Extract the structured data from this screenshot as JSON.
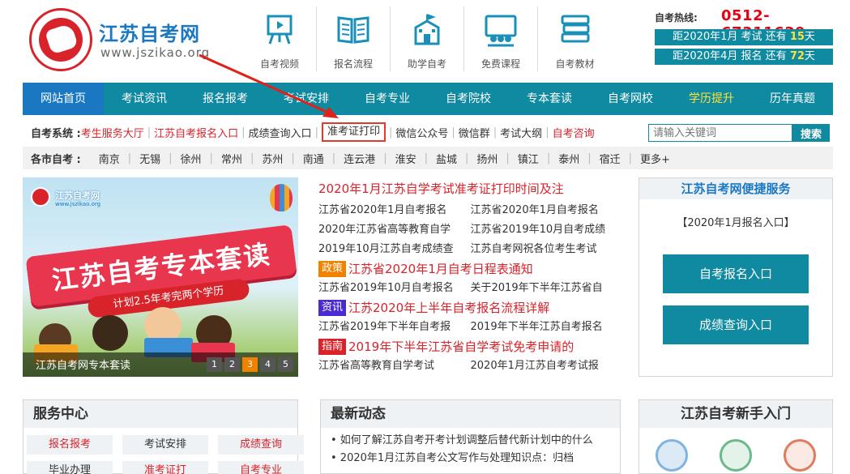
{
  "header": {
    "brand_name": "江苏自考网",
    "brand_url": "www.jszikao.org",
    "topnav": [
      {
        "label": "自考视频",
        "icon": "video-board-icon"
      },
      {
        "label": "报名流程",
        "icon": "book-icon"
      },
      {
        "label": "助学自考",
        "icon": "school-icon"
      },
      {
        "label": "免费课程",
        "icon": "classroom-icon"
      },
      {
        "label": "自考教材",
        "icon": "textbooks-icon"
      }
    ],
    "hotline_label": "自考热线:",
    "hotline": "0512-67311639",
    "countdowns": [
      {
        "prefix": "距2020年1月 考试 还有 ",
        "num": "15",
        "suffix": "天"
      },
      {
        "prefix": "距2020年4月 报名 还有 ",
        "num": "72",
        "suffix": "天"
      }
    ]
  },
  "mainnav": [
    "网站首页",
    "考试资讯",
    "报名报考",
    "考试安排",
    "自考专业",
    "自考院校",
    "专本套读",
    "自考网校",
    "学历提升",
    "历年真题"
  ],
  "sysrow": {
    "title": "自考系统 :",
    "links": [
      "考生服务大厅",
      "江苏自考报名入口",
      "成绩查询入口",
      "准考证打印",
      "微信公众号",
      "微信群",
      "考试大纲",
      "自考咨询"
    ],
    "search_placeholder": "请输入关键词",
    "search_button": "搜索"
  },
  "cityrow": {
    "title": "各市自考 :",
    "cities": [
      "南京",
      "无锡",
      "徐州",
      "常州",
      "苏州",
      "南通",
      "连云港",
      "淮安",
      "盐城",
      "扬州",
      "镇江",
      "泰州",
      "宿迁",
      "更多+"
    ]
  },
  "banner": {
    "logo_name": "江苏自考网",
    "logo_url": "www.jszikao.org",
    "title": "江苏自考专本套读",
    "subtitle": "计划2.5年考完两个学历",
    "caption": "江苏自考网专本套读",
    "pages": [
      "1",
      "2",
      "3",
      "4",
      "5"
    ],
    "active_page": "3"
  },
  "news": {
    "headline": "2020年1月江苏自学考试准考证打印时间及注",
    "rows1": [
      [
        "江苏省2020年1月自考报名",
        "江苏省2020年1月自考报名"
      ],
      [
        "2020年江苏省高等教育自学",
        "江苏省2019年10月自考成绩"
      ],
      [
        "2019年10月江苏自考成绩查",
        "江苏自考网祝各位考生考试"
      ]
    ],
    "tag1": {
      "tag": "政策",
      "color": "#f08200",
      "text": "江苏省2020年1月自考日程表通知"
    },
    "row2": [
      "江苏省2019年10月自考报名",
      "关于2019年下半年江苏省自"
    ],
    "tag2": {
      "tag": "资讯",
      "color": "#4a2bd0",
      "text": "江苏2020年上半年自考报名流程详解"
    },
    "row3": [
      "江苏省2019年下半年自考报",
      "2019年下半年江苏自考报名"
    ],
    "tag3": {
      "tag": "指南",
      "color": "#d8232a",
      "text": "2019年下半年江苏省自学考试免考申请的"
    },
    "row4": [
      "江苏省高等教育自学考试",
      "2020年1月江苏自考考试报"
    ]
  },
  "services": {
    "title": "江苏自考网便捷服务",
    "note": "【2020年1月报名入口】",
    "btn1": "自考报名入口",
    "btn2": "成绩查询入口"
  },
  "service_center": {
    "title": "服务中心",
    "items": [
      {
        "label": "报名报考",
        "red": true
      },
      {
        "label": "考试安排",
        "red": false
      },
      {
        "label": "成绩查询",
        "red": true
      },
      {
        "label": "毕业办理",
        "red": false
      },
      {
        "label": "准考证打",
        "red": true
      },
      {
        "label": "自考专业",
        "red": true
      }
    ]
  },
  "latest": {
    "title": "最新动态",
    "items": [
      "• 如何了解江苏自考开考计划调整后替代新计划中的什么",
      "• 2020年1月江苏自考公文写作与处理知识点：归档"
    ]
  },
  "beginner": {
    "title": "江苏自考新手入门"
  },
  "colors": {
    "teal": "#0f8aa0",
    "blue": "#1a78c2",
    "red": "#d8232a",
    "yellow": "#ffe23a",
    "orange": "#f08200"
  }
}
